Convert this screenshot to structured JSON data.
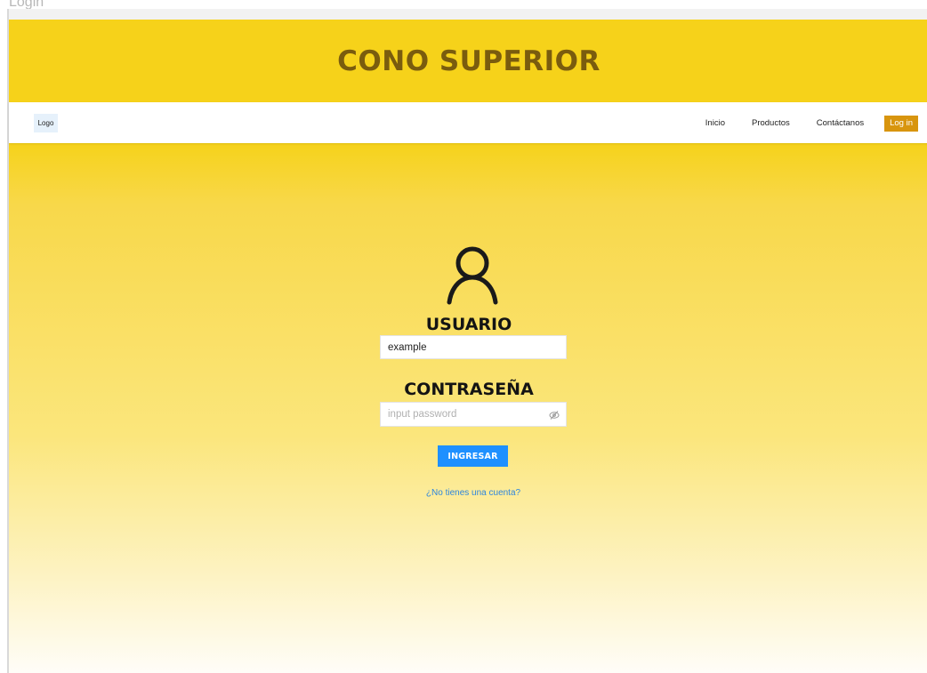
{
  "page": {
    "tab_label": "Login"
  },
  "banner": {
    "title": "CONO SUPERIOR"
  },
  "navbar": {
    "logo_label": "Logo",
    "links": [
      "Inicio",
      "Productos",
      "Contáctanos"
    ],
    "login_button": "Log in"
  },
  "form": {
    "user_icon": "user-icon",
    "username_label": "USUARIO",
    "username_value": "example",
    "password_label": "CONTRASEÑA",
    "password_placeholder": "input password",
    "password_toggle_icon": "eye-slash-icon",
    "submit_label": "INGRESAR",
    "register_link": "¿No tienes una cuenta?"
  },
  "colors": {
    "banner_yellow": "#f6d21a",
    "banner_title": "#7a5c0e",
    "login_button": "#d8950e",
    "submit_button": "#1e90ff",
    "link": "#2e86de"
  }
}
